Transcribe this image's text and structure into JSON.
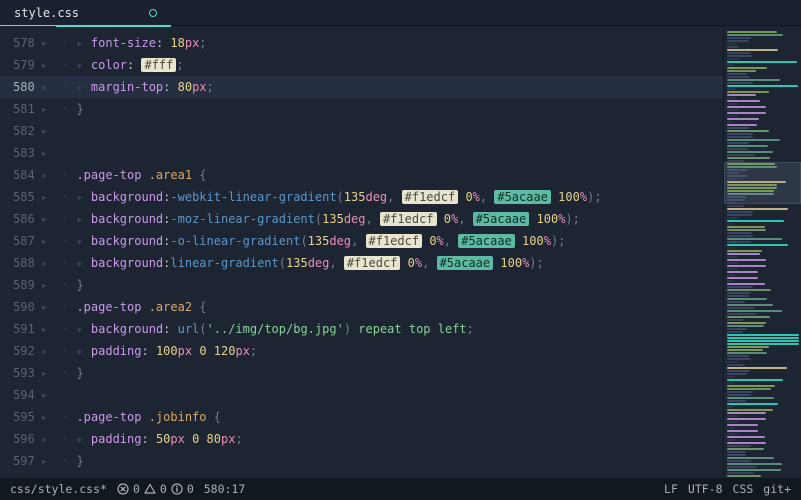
{
  "tab": {
    "title": "style.css",
    "modified": true
  },
  "gutter": {
    "start": 578,
    "count": 20,
    "cursorLine": 580
  },
  "linesMeta": {
    "indentCols": [
      2,
      2,
      2,
      1,
      0,
      0,
      1,
      2,
      2,
      2,
      2,
      1,
      1,
      2,
      2,
      1,
      0,
      1,
      2,
      1
    ],
    "tokens": [
      [
        [
          "font-size",
          "kw"
        ],
        [
          ": ",
          "col"
        ],
        [
          "18",
          "num"
        ],
        [
          "px",
          "unit"
        ],
        [
          ";",
          "pm"
        ]
      ],
      [
        [
          "color",
          "kw"
        ],
        [
          ": ",
          "col"
        ],
        [
          "#fff",
          "chip c1"
        ],
        [
          ";",
          "pm"
        ]
      ],
      [
        [
          "margin-top",
          "kw"
        ],
        [
          ": ",
          "col"
        ],
        [
          "80",
          "num"
        ],
        [
          "px",
          "unit"
        ],
        [
          ";",
          "pm"
        ]
      ],
      [
        [
          "}",
          "pm"
        ]
      ],
      [],
      [],
      [
        [
          ".page-top ",
          ".sel"
        ],
        [
          ".area1 ",
          "cls"
        ],
        [
          "{",
          "pm"
        ]
      ],
      [
        [
          "background",
          "kw"
        ],
        [
          ":",
          "col"
        ],
        [
          "-webkit-linear-gradient",
          "fn"
        ],
        [
          "(",
          "pm"
        ],
        [
          "135",
          "num"
        ],
        [
          "deg",
          "unit"
        ],
        [
          ", ",
          "pm"
        ],
        [
          "#f1edcf",
          "chip c1"
        ],
        [
          " ",
          "col"
        ],
        [
          "0",
          "num"
        ],
        [
          "%",
          "unit"
        ],
        [
          ", ",
          "pm"
        ],
        [
          "#5acaae",
          "chip c2"
        ],
        [
          " ",
          "col"
        ],
        [
          "100",
          "num"
        ],
        [
          "%",
          "unit"
        ],
        [
          ")",
          "pm"
        ],
        [
          ";",
          "pm"
        ]
      ],
      [
        [
          "background",
          "kw"
        ],
        [
          ":",
          "col"
        ],
        [
          "-moz-linear-gradient",
          "fn"
        ],
        [
          "(",
          "pm"
        ],
        [
          "135",
          "num"
        ],
        [
          "deg",
          "unit"
        ],
        [
          ", ",
          "pm"
        ],
        [
          "#f1edcf",
          "chip c1"
        ],
        [
          " ",
          "col"
        ],
        [
          "0",
          "num"
        ],
        [
          "%",
          "unit"
        ],
        [
          ", ",
          "pm"
        ],
        [
          "#5acaae",
          "chip c2"
        ],
        [
          " ",
          "col"
        ],
        [
          "100",
          "num"
        ],
        [
          "%",
          "unit"
        ],
        [
          ")",
          "pm"
        ],
        [
          ";",
          "pm"
        ]
      ],
      [
        [
          "background",
          "kw"
        ],
        [
          ":",
          "col"
        ],
        [
          "-o-linear-gradient",
          "fn"
        ],
        [
          "(",
          "pm"
        ],
        [
          "135",
          "num"
        ],
        [
          "deg",
          "unit"
        ],
        [
          ", ",
          "pm"
        ],
        [
          "#f1edcf",
          "chip c1"
        ],
        [
          " ",
          "col"
        ],
        [
          "0",
          "num"
        ],
        [
          "%",
          "unit"
        ],
        [
          ", ",
          "pm"
        ],
        [
          "#5acaae",
          "chip c2"
        ],
        [
          " ",
          "col"
        ],
        [
          "100",
          "num"
        ],
        [
          "%",
          "unit"
        ],
        [
          ")",
          "pm"
        ],
        [
          ";",
          "pm"
        ]
      ],
      [
        [
          "background",
          "kw"
        ],
        [
          ":",
          "col"
        ],
        [
          "linear-gradient",
          "fn"
        ],
        [
          "(",
          "pm"
        ],
        [
          "135",
          "num"
        ],
        [
          "deg",
          "unit"
        ],
        [
          ", ",
          "pm"
        ],
        [
          "#f1edcf",
          "chip c1"
        ],
        [
          " ",
          "col"
        ],
        [
          "0",
          "num"
        ],
        [
          "%",
          "unit"
        ],
        [
          ", ",
          "pm"
        ],
        [
          "#5acaae",
          "chip c2"
        ],
        [
          " ",
          "col"
        ],
        [
          "100",
          "num"
        ],
        [
          "%",
          "unit"
        ],
        [
          ")",
          "pm"
        ],
        [
          ";",
          "pm"
        ]
      ],
      [
        [
          "}",
          "pm"
        ]
      ],
      [
        [
          ".page-top ",
          ".sel"
        ],
        [
          ".area2 ",
          "cls"
        ],
        [
          "{",
          "pm"
        ]
      ],
      [
        [
          "background",
          "kw"
        ],
        [
          ": ",
          "col"
        ],
        [
          "url",
          "fn"
        ],
        [
          "(",
          "pm"
        ],
        [
          "'../img/top/bg.jpg'",
          "grn"
        ],
        [
          ")",
          "pm"
        ],
        [
          " repeat top left",
          "str"
        ],
        [
          ";",
          "pm"
        ]
      ],
      [
        [
          "padding",
          "kw"
        ],
        [
          ": ",
          "col"
        ],
        [
          "100",
          "num"
        ],
        [
          "px",
          "unit"
        ],
        [
          " ",
          "col"
        ],
        [
          "0",
          "num"
        ],
        [
          " ",
          "col"
        ],
        [
          "120",
          "num"
        ],
        [
          "px",
          "unit"
        ],
        [
          ";",
          "pm"
        ]
      ],
      [
        [
          "}",
          "pm"
        ]
      ],
      [],
      [
        [
          ".page-top ",
          ".sel"
        ],
        [
          ".jobinfo ",
          "cls"
        ],
        [
          "{",
          "pm"
        ]
      ],
      [
        [
          "padding",
          "kw"
        ],
        [
          ": ",
          "col"
        ],
        [
          "50",
          "num"
        ],
        [
          "px",
          "unit"
        ],
        [
          " ",
          "col"
        ],
        [
          "0",
          "num"
        ],
        [
          " ",
          "col"
        ],
        [
          "80",
          "num"
        ],
        [
          "px",
          "unit"
        ],
        [
          ";",
          "pm"
        ]
      ],
      [
        [
          "}",
          "pm"
        ]
      ]
    ]
  },
  "status": {
    "left": {
      "path": "css/style.css*",
      "errors": "0",
      "warnings": "0",
      "info": "0",
      "cursor": "580:17"
    },
    "right": {
      "eol": "LF",
      "encoding": "UTF-8",
      "lang": "CSS",
      "git": "git+"
    }
  },
  "minimap": {
    "pattern": "736a756c756c746c74746a746f706f716f716f716f716f6b706e746c74746a6b706e7174746d737174746c6b6b6b6d717473746c6b",
    "colors": {
      "6": "#3e4c63",
      "7": "#4e5c84",
      "a": "#6e8f6e",
      "b": "#7b9a4f",
      "c": "#5a8c7e",
      "d": "#c2b08a",
      "e": "#2cc7b2",
      "f": "#a884c4",
      "0": "#2b3346",
      "1": "#2b3346",
      "3": "#364056",
      "4": "#3a4660",
      "5": "#3b4254"
    },
    "widths": {
      "6": 22,
      "7": 34,
      "a": 44,
      "b": 50,
      "c": 56,
      "d": 62,
      "e": 72,
      "f": 40,
      "0": 8,
      "1": 12,
      "3": 18,
      "4": 26,
      "5": 30
    }
  }
}
